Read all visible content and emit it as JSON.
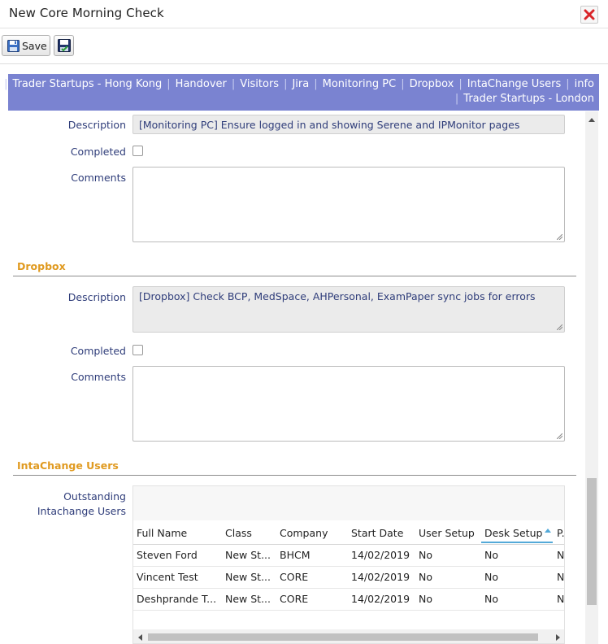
{
  "window": {
    "title": "New Core Morning Check"
  },
  "toolbar": {
    "save_label": "Save"
  },
  "nav": {
    "line1": [
      "Trader Startups - Hong Kong",
      "Handover",
      "Visitors",
      "Jira",
      "Monitoring PC",
      "Dropbox",
      "IntaChange Users",
      "info"
    ],
    "line2": [
      "Trader Startups - London"
    ]
  },
  "monitoring": {
    "description_label": "Description",
    "description_value": "[Monitoring PC] Ensure logged in and showing Serene and IPMonitor pages",
    "completed_label": "Completed",
    "comments_label": "Comments"
  },
  "dropbox": {
    "title": "Dropbox",
    "description_label": "Description",
    "description_value": "[Dropbox] Check BCP, MedSpace, AHPersonal, ExamPaper sync jobs for errors",
    "completed_label": "Completed",
    "comments_label": "Comments"
  },
  "intachange": {
    "title": "IntaChange Users",
    "outstanding_label_1": "Outstanding",
    "outstanding_label_2": "Intachange Users",
    "grid": {
      "columns": [
        "Full Name",
        "Class",
        "Company",
        "Start Date",
        "User Setup",
        "Desk Setup",
        "P..."
      ],
      "sorted_column": "Desk Setup",
      "rows": [
        [
          "Steven Ford",
          "New St...",
          "BHCM",
          "14/02/2019",
          "No",
          "No",
          "N"
        ],
        [
          "Vincent Test",
          "New St...",
          "CORE",
          "14/02/2019",
          "No",
          "No",
          "N"
        ],
        [
          "Deshprande T...",
          "New St...",
          "CORE",
          "14/02/2019",
          "No",
          "No",
          "N"
        ]
      ]
    }
  },
  "icons": {
    "save": "floppy-disk-icon",
    "save_close": "floppy-disk-check-icon",
    "close": "close-x-icon",
    "sort": "sort-ascending-icon"
  },
  "colors": {
    "nav_bg": "#7a83d1",
    "section_title": "#e09a20",
    "label": "#2f3d7a",
    "close_x": "#d9262a"
  }
}
